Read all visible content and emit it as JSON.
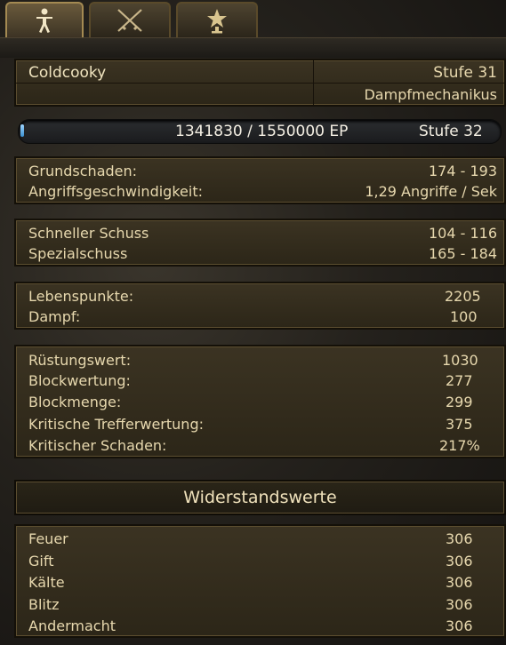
{
  "tabs": [
    {
      "icon": "character-icon",
      "active": true
    },
    {
      "icon": "crossed-swords-icon",
      "active": false
    },
    {
      "icon": "star-medal-icon",
      "active": false
    }
  ],
  "header": {
    "name": "Coldcooky",
    "level": "Stufe 31",
    "class": "Dampfmechanikus"
  },
  "experience": {
    "text": "1341830 / 1550000 EP",
    "next_level": "Stufe 32",
    "progress": 0.0
  },
  "damage": {
    "base_label": "Grundschaden:",
    "base_value": "174 - 193",
    "speed_label": "Angriffsgeschwindigkeit:",
    "speed_value": "1,29 Angriffe / Sek"
  },
  "skills": {
    "quick_label": "Schneller Schuss",
    "quick_value": "104 - 116",
    "special_label": "Spezialschuss",
    "special_value": "165 - 184"
  },
  "vitals": {
    "hp_label": "Lebenspunkte:",
    "hp_value": "2205",
    "steam_label": "Dampf:",
    "steam_value": "100"
  },
  "defense": [
    {
      "label": "Rüstungswert:",
      "value": "1030"
    },
    {
      "label": "Blockwertung:",
      "value": "277"
    },
    {
      "label": "Blockmenge:",
      "value": "299"
    },
    {
      "label": "Kritische Trefferwertung:",
      "value": "375"
    },
    {
      "label": "Kritischer Schaden:",
      "value": "217%"
    }
  ],
  "resistances": {
    "title": "Widerstandswerte",
    "items": [
      {
        "label": "Feuer",
        "value": "306"
      },
      {
        "label": "Gift",
        "value": "306"
      },
      {
        "label": "Kälte",
        "value": "306"
      },
      {
        "label": "Blitz",
        "value": "306"
      },
      {
        "label": "Andermacht",
        "value": "306"
      }
    ]
  },
  "colors": {
    "text": "#e7d8ae",
    "panel": "#3b3322",
    "xp_fill": "#3a8fd0"
  }
}
